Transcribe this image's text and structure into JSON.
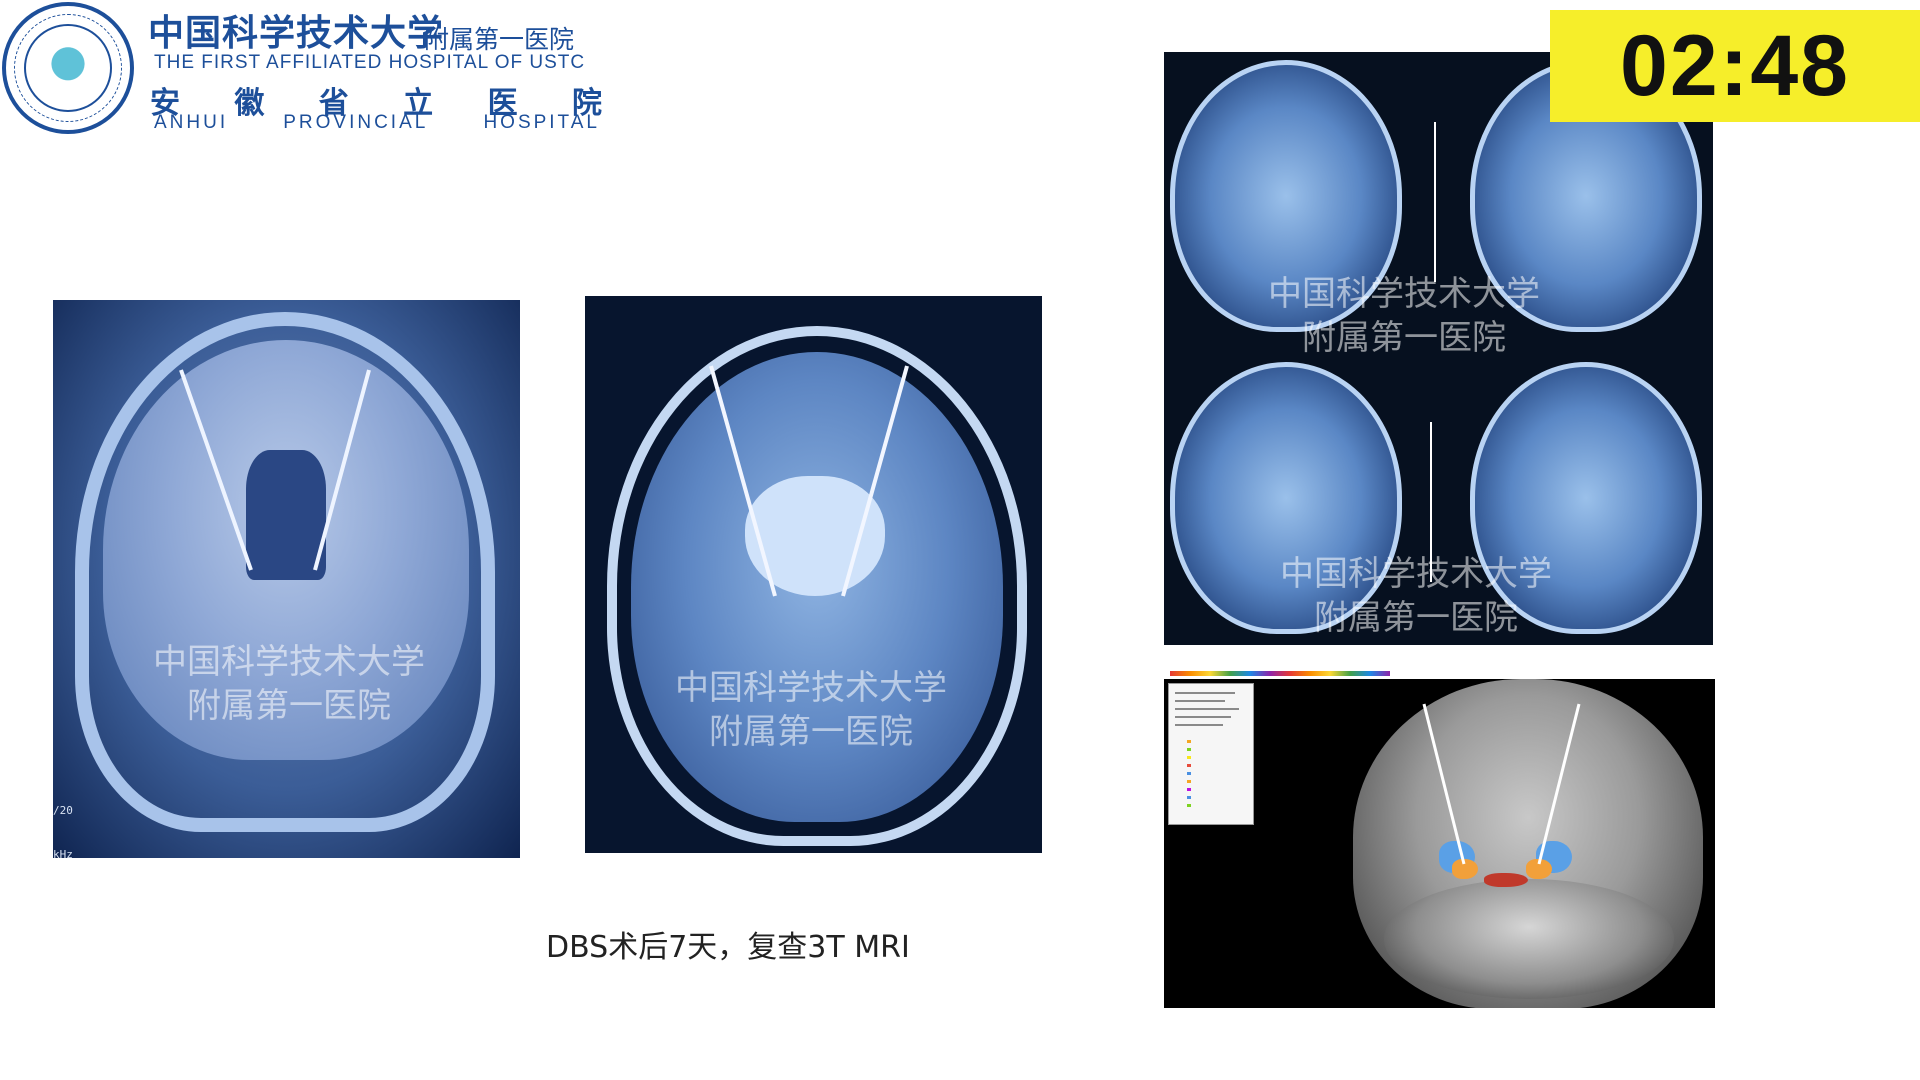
{
  "header": {
    "hospital_cn": "中国科学技术大学",
    "hospital_cn_sub": "附属第一医院",
    "hospital_en": "THE FIRST AFFILIATED HOSPITAL OF USTC",
    "province_cn": [
      "安",
      "徽",
      "省",
      "立",
      "医",
      "院"
    ],
    "province_en": [
      "ANHUI",
      "PROVINCIAL",
      "HOSPITAL"
    ]
  },
  "timer": {
    "value": "02:48",
    "background": "#f6ee2a"
  },
  "images": {
    "watermark_line1": "中国科学技术大学",
    "watermark_line2": "附属第一医院",
    "coronal_corner_label_1": "/20",
    "coronal_corner_label_2": "kHz"
  },
  "caption": "DBS术后7天，复查3T MRI",
  "colors": {
    "brand_blue": "#1d4f9a"
  }
}
